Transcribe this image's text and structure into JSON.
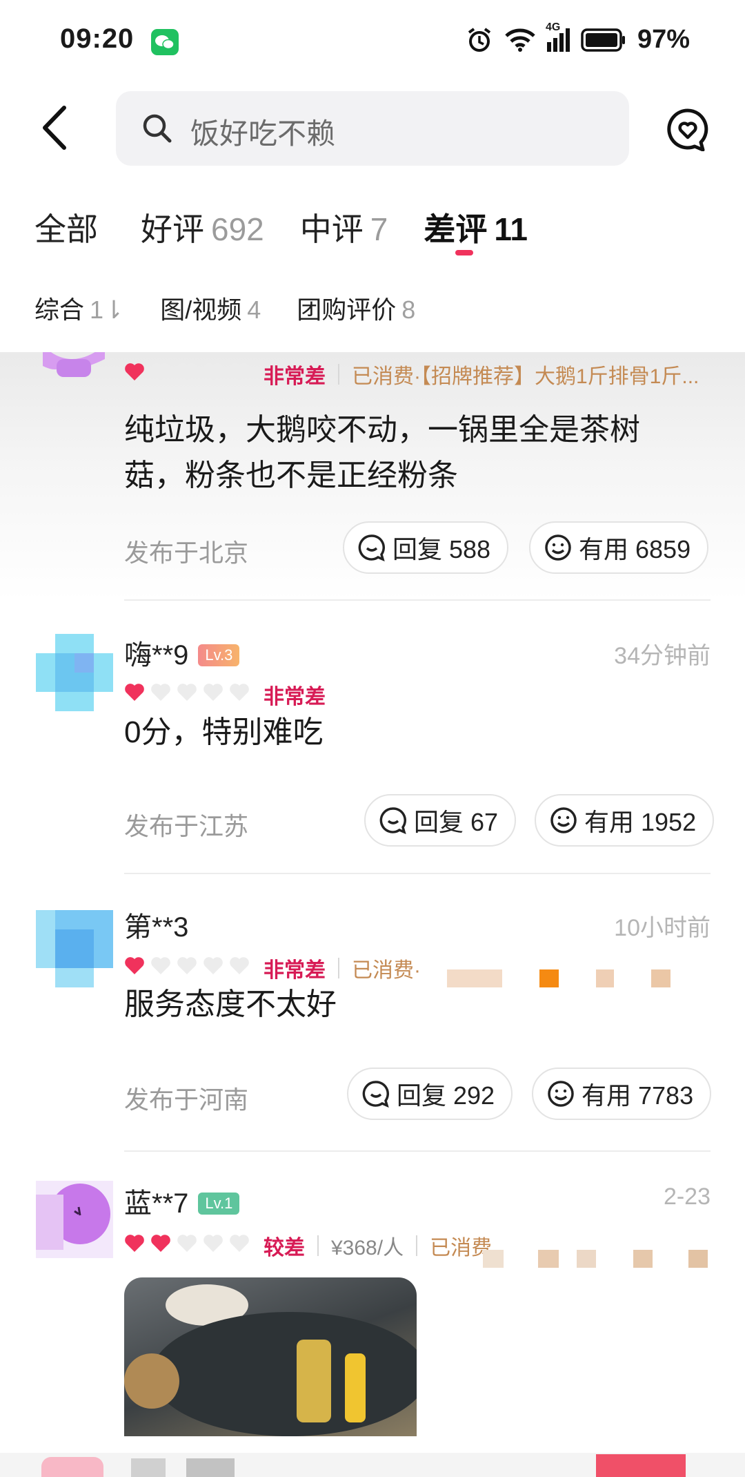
{
  "status_bar": {
    "time": "09:20",
    "network": "4G",
    "battery": "97%"
  },
  "search": {
    "text": "饭好吃不赖"
  },
  "tabs": [
    {
      "label": "全部",
      "count": ""
    },
    {
      "label": "好评",
      "count": "692"
    },
    {
      "label": "中评",
      "count": "7"
    },
    {
      "label": "差评",
      "count": "11"
    }
  ],
  "active_tab": "差评",
  "sub_tabs": [
    {
      "label": "综合",
      "count": "1⇂"
    },
    {
      "label": "图/视频",
      "count": "4"
    },
    {
      "label": "团购评价",
      "count": "8"
    }
  ],
  "reviews": [
    {
      "rating_label": "非常差",
      "hearts_filled": 1,
      "consumed": "已消费·【招牌推荐】大鹅1斤排骨1斤...",
      "content": "纯垃圾，大鹅咬不动，一锅里全是茶树菇，粉条也不是正经粉条",
      "location": "发布于北京",
      "reply": "回复 588",
      "useful": "有用 6859"
    },
    {
      "name": "嗨**9",
      "level": "Lv.3",
      "time": "34分钟前",
      "rating_label": "非常差",
      "hearts_filled": 1,
      "content": "0分，特别难吃",
      "location": "发布于江苏",
      "reply": "回复 67",
      "useful": "有用 1952"
    },
    {
      "name": "第**3",
      "time": "10小时前",
      "rating_label": "非常差",
      "hearts_filled": 1,
      "consumed": "已消费·",
      "content": "服务态度不太好",
      "location": "发布于河南",
      "reply": "回复 292",
      "useful": "有用 7783"
    },
    {
      "name": "蓝**7",
      "level": "Lv.1",
      "time": "2-23",
      "rating_label": "较差",
      "hearts_filled": 2,
      "price": "¥368/人",
      "consumed": "已消费"
    }
  ],
  "colors": {
    "accent": "#f0325c",
    "rating": "#d71b55",
    "consumed": "#c48a53",
    "lv3": "#f7a36b",
    "lv1": "#5fc59d"
  }
}
